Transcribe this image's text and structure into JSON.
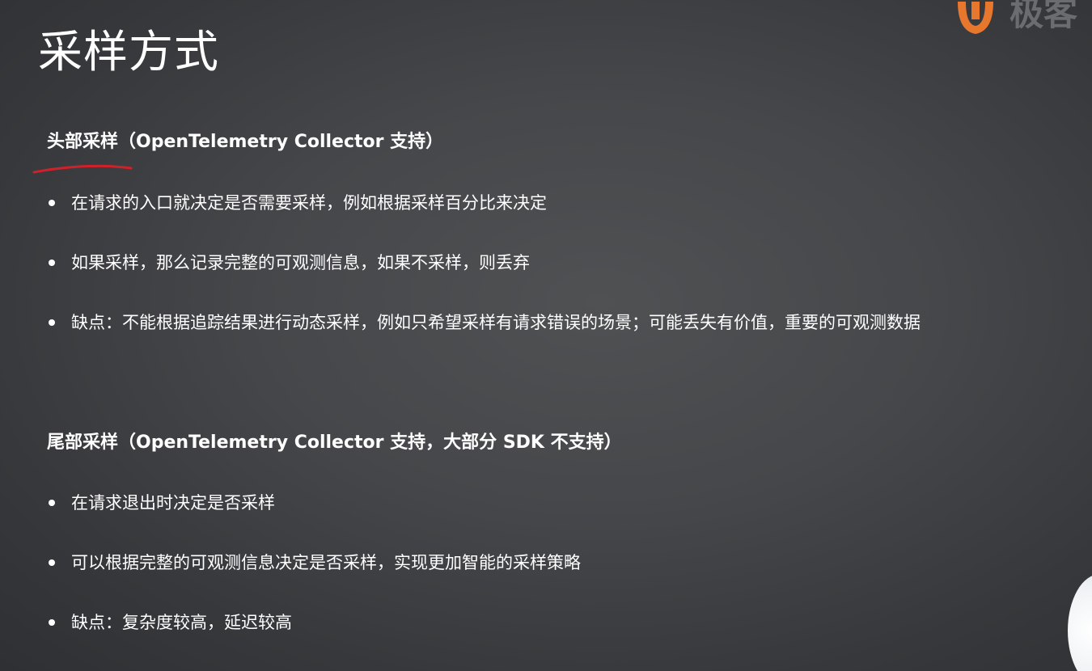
{
  "slide": {
    "title": "采样方式",
    "logo": {
      "text": "极客",
      "color": "#e8772e"
    },
    "head_sampling": {
      "heading": "头部采样（OpenTelemetry Collector 支持）",
      "bullets": [
        "在请求的入口就决定是否需要采样，例如根据采样百分比来决定",
        "如果采样，那么记录完整的可观测信息，如果不采样，则丢弃",
        "缺点：不能根据追踪结果进行动态采样，例如只希望采样有请求错误的场景；可能丢失有价值，重要的可观测数据"
      ]
    },
    "tail_sampling": {
      "heading": "尾部采样（OpenTelemetry Collector 支持，大部分 SDK 不支持）",
      "bullets": [
        "在请求退出时决定是否采样",
        "可以根据完整的可观测信息决定是否采样，实现更加智能的采样策略",
        "缺点：复杂度较高，延迟较高"
      ]
    },
    "annotation_color": "#d0212b"
  }
}
